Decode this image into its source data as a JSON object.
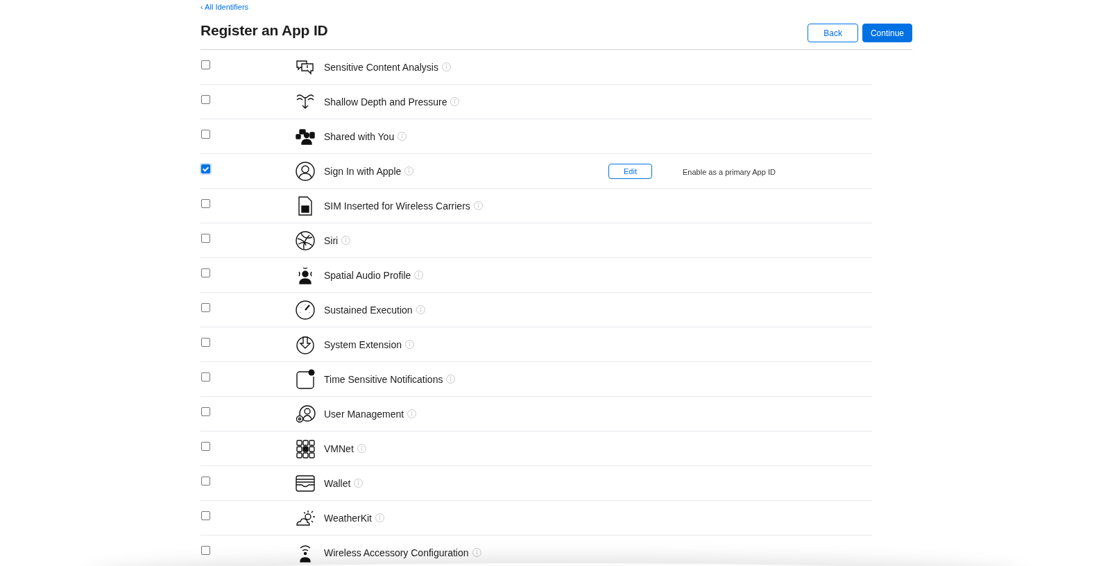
{
  "breadcrumb": "‹ All Identifiers",
  "title": "Register an App ID",
  "buttons": [
    {
      "label": "Back",
      "kind": "secondary"
    },
    {
      "label": "Continue",
      "kind": "primary"
    }
  ],
  "capabilities": [
    {
      "name": "Sensitive Content Analysis",
      "checked": false
    },
    {
      "name": "Shallow Depth and Pressure",
      "checked": false
    },
    {
      "name": "Shared with You",
      "checked": false
    },
    {
      "name": "Sign In with Apple",
      "checked": true,
      "action": "Edit",
      "note": "Enable as a primary App ID"
    },
    {
      "name": "SIM Inserted for Wireless Carriers",
      "checked": false
    },
    {
      "name": "Siri",
      "checked": false
    },
    {
      "name": "Spatial Audio Profile",
      "checked": false
    },
    {
      "name": "Sustained Execution",
      "checked": false
    },
    {
      "name": "System Extension",
      "checked": false
    },
    {
      "name": "Time Sensitive Notifications",
      "checked": false
    },
    {
      "name": "User Management",
      "checked": false
    },
    {
      "name": "VMNet",
      "checked": false
    },
    {
      "name": "Wallet",
      "checked": false
    },
    {
      "name": "WeatherKit",
      "checked": false
    },
    {
      "name": "Wireless Accessory Configuration",
      "checked": false
    }
  ]
}
